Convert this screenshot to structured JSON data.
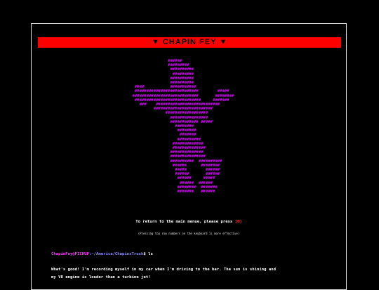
{
  "banner": {
    "title": "▼ CHAPIN FEY ▼"
  },
  "ascii_art": {
    "color": "#d900ff",
    "text": "                ######\n                #########\n                 ##########\n                  #########\n                 ##########\n                 ##########\n  ####           ###########\n  ###########################        #####\n ############################       ########\n  ############################     #######\n    ###    ###########################\n          #########################\n               ##################\n                 ################\n                 ############ #####\n                   ########\n                    ########\n                     #######\n                    ##########\n                  #############\n                  ##############\n                 ##############\n                 ###############\n                 ##########  ##########\n                  ######      ########\n                   #####        ######\n                   ######       ######\n                    ######     #####\n                     ######  ######\n                    ########  #######\n                    #######   ######"
  },
  "return_line": {
    "text": "To return to the main menue, please press ",
    "key": "[0]"
  },
  "hint": "(Pressing top row numbers on the keyboard is more effective)",
  "terminal": {
    "user": "ChapinFey@PICKUP",
    "path": ":~/America/ChapinsTruck",
    "cmd": "$ ls"
  },
  "story": {
    "line1": "What's good! I'm recording myself in my car when I'm driving to the bar. The sun is shining and",
    "line2": "my V8 engine is louder than a turbine jet!"
  },
  "colors": {
    "background": "#000000",
    "banner": "#ff0000",
    "art": "#d900ff",
    "key": "#ff2a2a",
    "user": "#ff3cff",
    "path": "#8a8cff"
  }
}
